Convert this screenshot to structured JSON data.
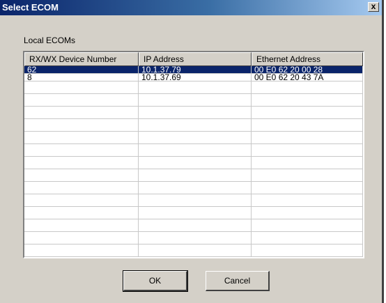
{
  "window": {
    "title": "Select ECOM",
    "close_label": "x"
  },
  "group": {
    "label": "Local ECOMs"
  },
  "table": {
    "columns": [
      "RX/WX Device Number",
      "IP Address",
      "Ethernet Address"
    ],
    "rows": [
      {
        "device": "62",
        "ip": "10.1.37.79",
        "ethernet": "00 E0 62 20 00 28",
        "selected": true
      },
      {
        "device": "8",
        "ip": "10.1.37.69",
        "ethernet": "00 E0 62 20 43 7A",
        "selected": false
      }
    ]
  },
  "buttons": {
    "ok_label": "OK",
    "cancel_label": "Cancel"
  }
}
